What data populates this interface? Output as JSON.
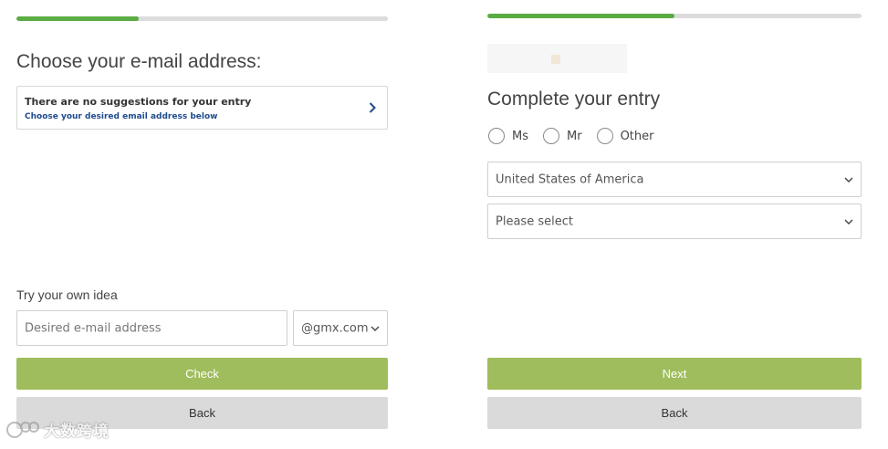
{
  "left": {
    "progress": 0.33,
    "title": "Choose your e-mail address:",
    "suggestion": {
      "line1": "There are no suggestions for your entry",
      "line2": "Choose your desired email address below",
      "icon": "chevron-right-icon"
    },
    "own_idea_label": "Try your own idea",
    "email_input": {
      "value": "",
      "placeholder": "Desired e-mail address"
    },
    "domain_select": {
      "selected": "@gmx.com",
      "icon": "chevron-down-icon"
    },
    "check_label": "Check",
    "back_label": "Back"
  },
  "right": {
    "progress": 0.5,
    "title": "Complete your entry",
    "salutation": [
      {
        "label": "Ms"
      },
      {
        "label": "Mr"
      },
      {
        "label": "Other"
      }
    ],
    "country_select": {
      "selected": "United States of America",
      "icon": "chevron-down-icon"
    },
    "state_select": {
      "selected": "Please select",
      "icon": "chevron-down-icon"
    },
    "next_label": "Next",
    "back_label": "Back"
  },
  "colors": {
    "progress_fill": "#5aac44",
    "primary_button": "#9fbd5c",
    "secondary_button": "#dadada",
    "link_text": "#1f4b8e"
  },
  "watermark": {
    "text": "大数跨境",
    "icon": "watermark-logo-icon"
  }
}
